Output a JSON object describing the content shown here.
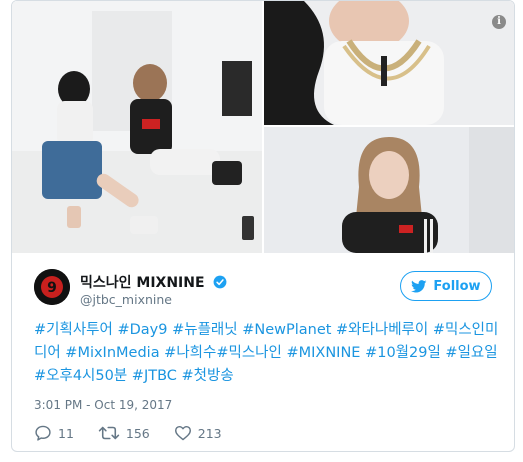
{
  "tweet": {
    "display_name": "믹스나인 MIXNINE",
    "handle": "@jtbc_mixnine",
    "follow_label": "Follow",
    "text": "#기획사투어 #Day9 #뉴플래닛 #NewPlanet #와타나베루이 #믹스인미디어 #MixInMedia #나희수#믹스나인 #MIXNINE #10월29일 #일요일 #오후4시50분 #JTBC #첫방송",
    "timestamp": "3:01 PM - Oct 19, 2017",
    "replies": "11",
    "retweets": "156",
    "likes": "213",
    "info_glyph": "i"
  },
  "colors": {
    "accent": "#1da1f2",
    "hashtag": "#1b95e0",
    "muted": "#657786",
    "border": "#d6dde3"
  },
  "icons": {
    "reply": "reply-icon",
    "retweet": "retweet-icon",
    "like": "heart-icon",
    "verified": "verified-badge-icon",
    "follow": "twitter-bird-icon",
    "info": "info-icon"
  }
}
